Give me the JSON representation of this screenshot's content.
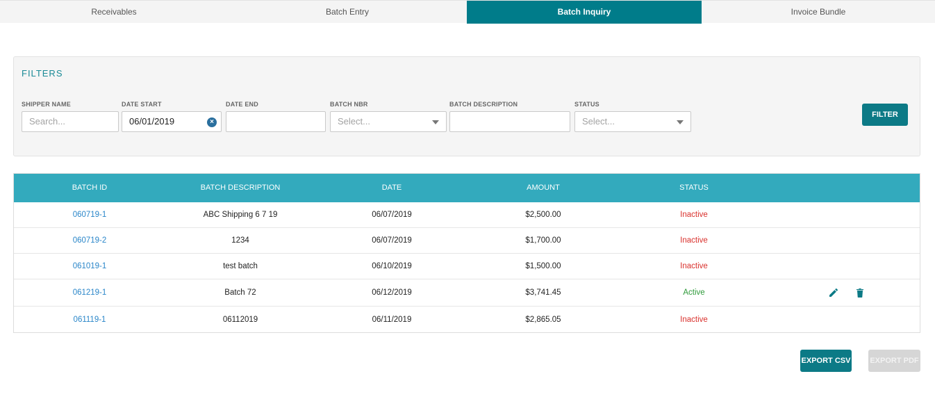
{
  "tabs": [
    {
      "label": "Receivables"
    },
    {
      "label": "Batch Entry"
    },
    {
      "label": "Batch Inquiry"
    },
    {
      "label": "Invoice Bundle"
    }
  ],
  "filters": {
    "title": "FILTERS",
    "shipper_name": {
      "label": "SHIPPER NAME",
      "placeholder": "Search...",
      "value": ""
    },
    "date_start": {
      "label": "DATE START",
      "value": "06/01/2019"
    },
    "date_end": {
      "label": "DATE END",
      "value": ""
    },
    "batch_nbr": {
      "label": "BATCH NBR",
      "placeholder": "Select..."
    },
    "batch_description": {
      "label": "BATCH DESCRIPTION",
      "value": ""
    },
    "status": {
      "label": "STATUS",
      "placeholder": "Select..."
    },
    "filter_button": "FILTER"
  },
  "table": {
    "headers": [
      "BATCH ID",
      "BATCH DESCRIPTION",
      "DATE",
      "AMOUNT",
      "STATUS"
    ],
    "rows": [
      {
        "id": "060719-1",
        "description": "ABC Shipping 6 7 19",
        "date": "06/07/2019",
        "amount": "$2,500.00",
        "status": "Inactive"
      },
      {
        "id": "060719-2",
        "description": "1234",
        "date": "06/07/2019",
        "amount": "$1,700.00",
        "status": "Inactive"
      },
      {
        "id": "061019-1",
        "description": "test batch",
        "date": "06/10/2019",
        "amount": "$1,500.00",
        "status": "Inactive"
      },
      {
        "id": "061219-1",
        "description": "Batch 72",
        "date": "06/12/2019",
        "amount": "$3,741.45",
        "status": "Active"
      },
      {
        "id": "061119-1",
        "description": "06112019",
        "date": "06/11/2019",
        "amount": "$2,865.05",
        "status": "Inactive"
      }
    ]
  },
  "buttons": {
    "export_csv": "EXPORT CSV",
    "export_pdf": "EXPORT PDF"
  },
  "colors": {
    "brand_teal": "#007c8a",
    "header_teal": "#33aabd",
    "link_blue": "#2a86c9",
    "inactive_red": "#d9302c",
    "active_green": "#2e9a3a"
  },
  "icons": {
    "edit": "pencil-icon",
    "delete": "trash-icon",
    "clear": "clear-icon",
    "dropdown": "chevron-down-icon"
  }
}
